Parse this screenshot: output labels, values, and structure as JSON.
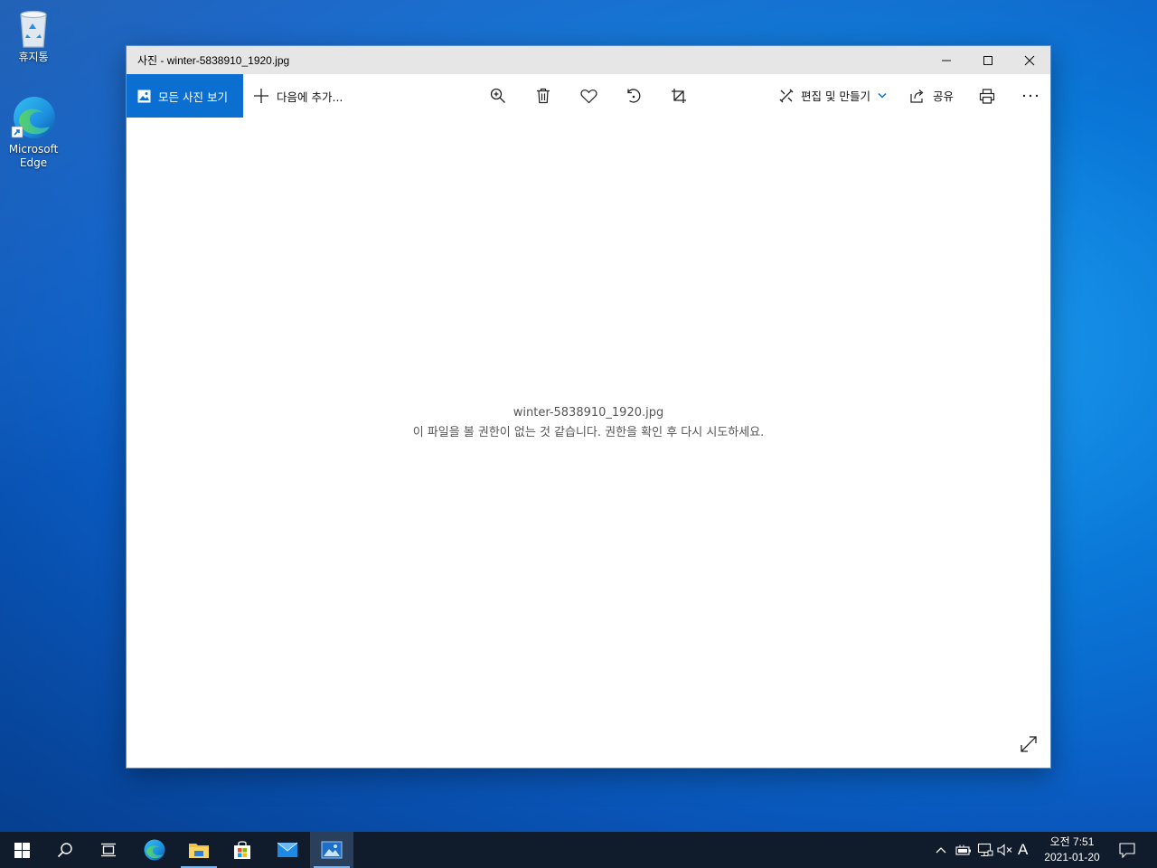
{
  "desktop": {
    "icons": [
      {
        "label": "휴지통",
        "icon": "recycle-bin-icon"
      },
      {
        "label_line1": "Microsoft",
        "label_line2": "Edge",
        "icon": "edge-icon"
      }
    ]
  },
  "window": {
    "title": "사진 - winter-5838910_1920.jpg",
    "toolbar": {
      "all_photos_label": "모든 사진 보기",
      "add_to_label": "다음에 추가...",
      "edit_create_label": "편집 및 만들기",
      "share_label": "공유"
    },
    "content": {
      "file_name": "winter-5838910_1920.jpg",
      "error_message": "이 파일을 볼 권한이 없는 것 같습니다. 권한을 확인 후 다시 시도하세요."
    }
  },
  "taskbar": {
    "apps": [
      "start",
      "search",
      "task-view",
      "edge",
      "file-explorer",
      "store",
      "mail",
      "photos"
    ],
    "active_app": "photos",
    "ime_indicator": "A",
    "clock": {
      "time": "오전 7:51",
      "date": "2021-01-20"
    }
  },
  "colors": {
    "accent": "#0a6fd0",
    "taskbar": "#101b2b"
  }
}
